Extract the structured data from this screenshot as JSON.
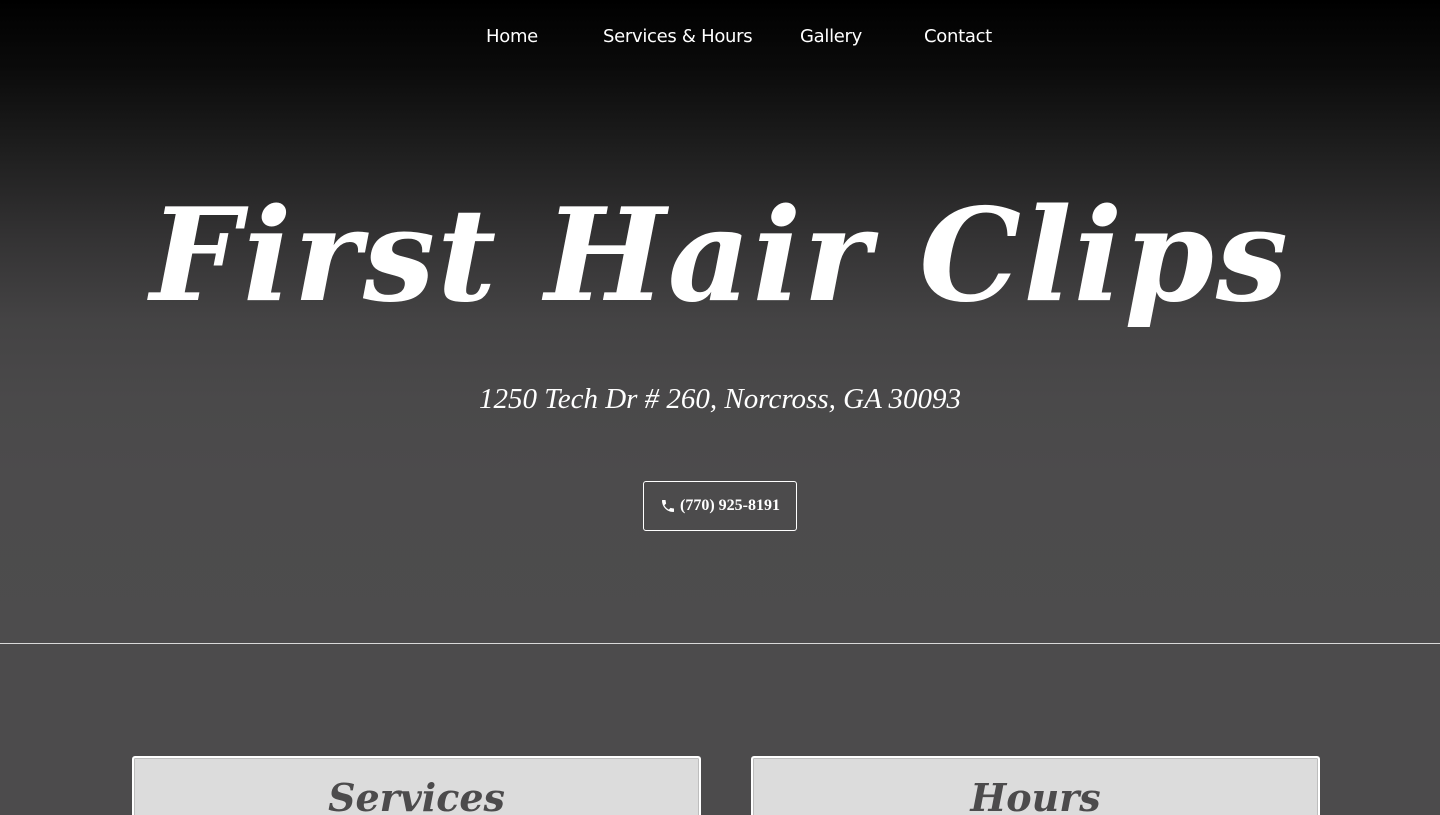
{
  "nav": {
    "items": [
      {
        "label": "Home"
      },
      {
        "label": "Services & Hours"
      },
      {
        "label": "Gallery"
      },
      {
        "label": "Contact"
      }
    ]
  },
  "hero": {
    "title": "First Hair Clips",
    "address": "1250 Tech Dr # 260, Norcross, GA 30093",
    "phone_label": "(770) 925-8191",
    "phone_icon": "phone-icon"
  },
  "sections": {
    "services_title": "Services",
    "hours_title": "Hours"
  },
  "colors": {
    "text": "#ffffff",
    "background": "#4c4b4c",
    "card": "#dcdcdc"
  }
}
